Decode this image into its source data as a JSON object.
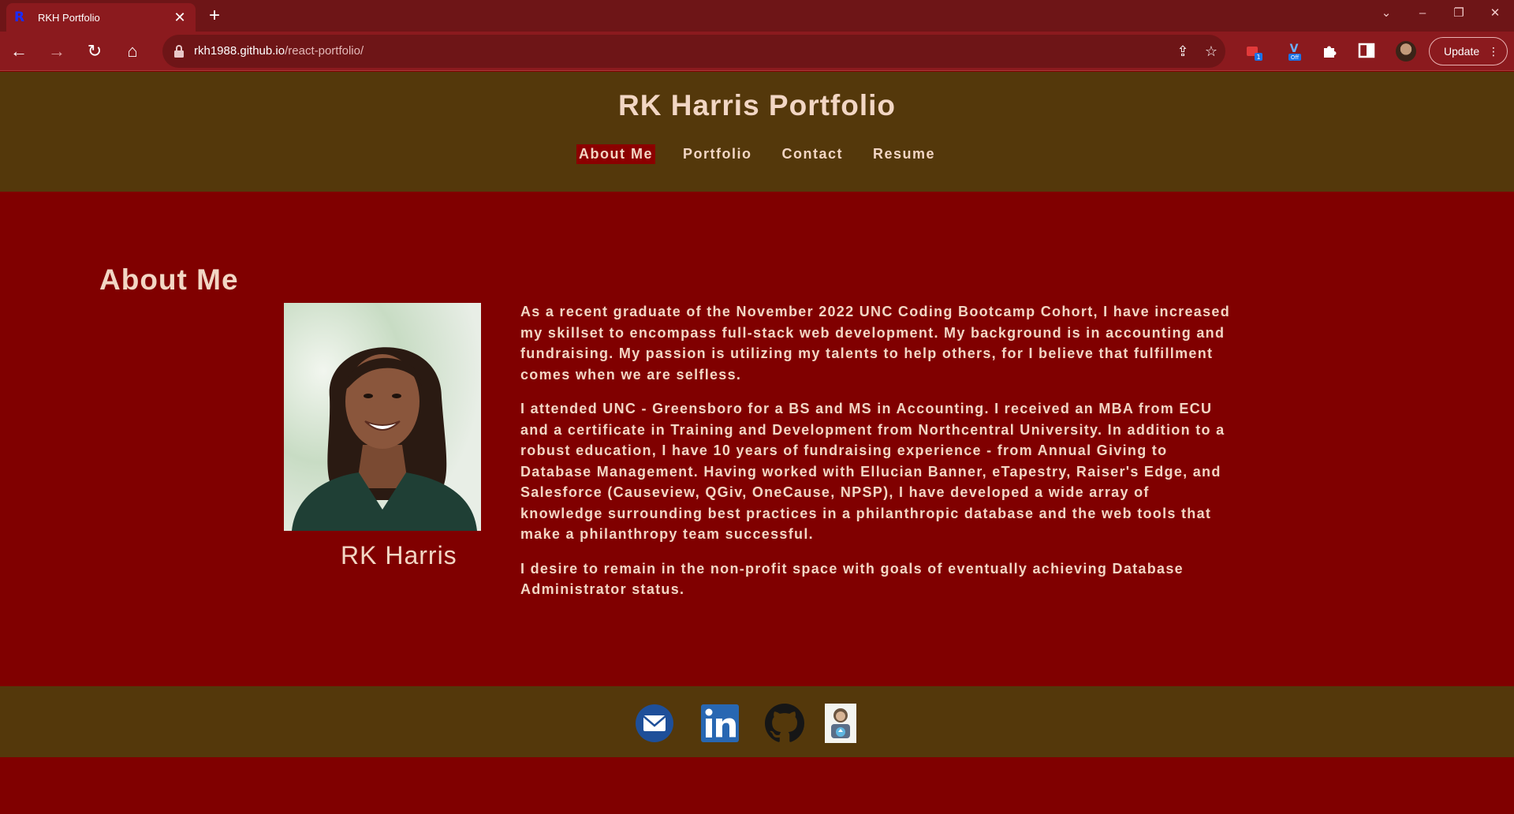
{
  "browser": {
    "tab_title": "RKH Portfolio",
    "favicon_letter": "R",
    "url_host": "rkh1988.github.io",
    "url_path": "/react-portfolio/",
    "update_label": "Update",
    "ext_badge_1": "1",
    "ext_badge_2": "Off"
  },
  "header": {
    "title": "RK Harris Portfolio",
    "nav": [
      {
        "label": "About Me"
      },
      {
        "label": "Portfolio"
      },
      {
        "label": "Contact"
      },
      {
        "label": "Resume"
      }
    ]
  },
  "about": {
    "heading": "About Me",
    "name": "RK Harris",
    "paragraphs": [
      "As a recent graduate of the November 2022 UNC Coding Bootcamp Cohort, I have increased my skillset to encompass full-stack web development. My background is in accounting and fundraising. My passion is utilizing my talents to help others, for I believe that fulfillment comes when we are selfless.",
      "I attended UNC - Greensboro for a BS and MS in Accounting. I received an MBA from ECU and a certificate in Training and Development from Northcentral University. In addition to a robust education, I have 10 years of fundraising experience - from Annual Giving to Database Management. Having worked with Ellucian Banner, eTapestry, Raiser's Edge, and Salesforce (Causeview, QGiv, OneCause, NPSP), I have developed a wide array of knowledge surrounding best practices in a philanthropic database and the web tools that make a philanthropy team successful.",
      "I desire to remain in the non-profit space with goals of eventually achieving Database Administrator status."
    ]
  },
  "colors": {
    "header_bg": "#54380b",
    "page_bg": "#800000",
    "text": "#f2d6c4",
    "active_nav_bg": "#8b0000"
  },
  "footer": {
    "icons": [
      "email-icon",
      "linkedin-icon",
      "github-icon",
      "trailhead-icon"
    ]
  }
}
